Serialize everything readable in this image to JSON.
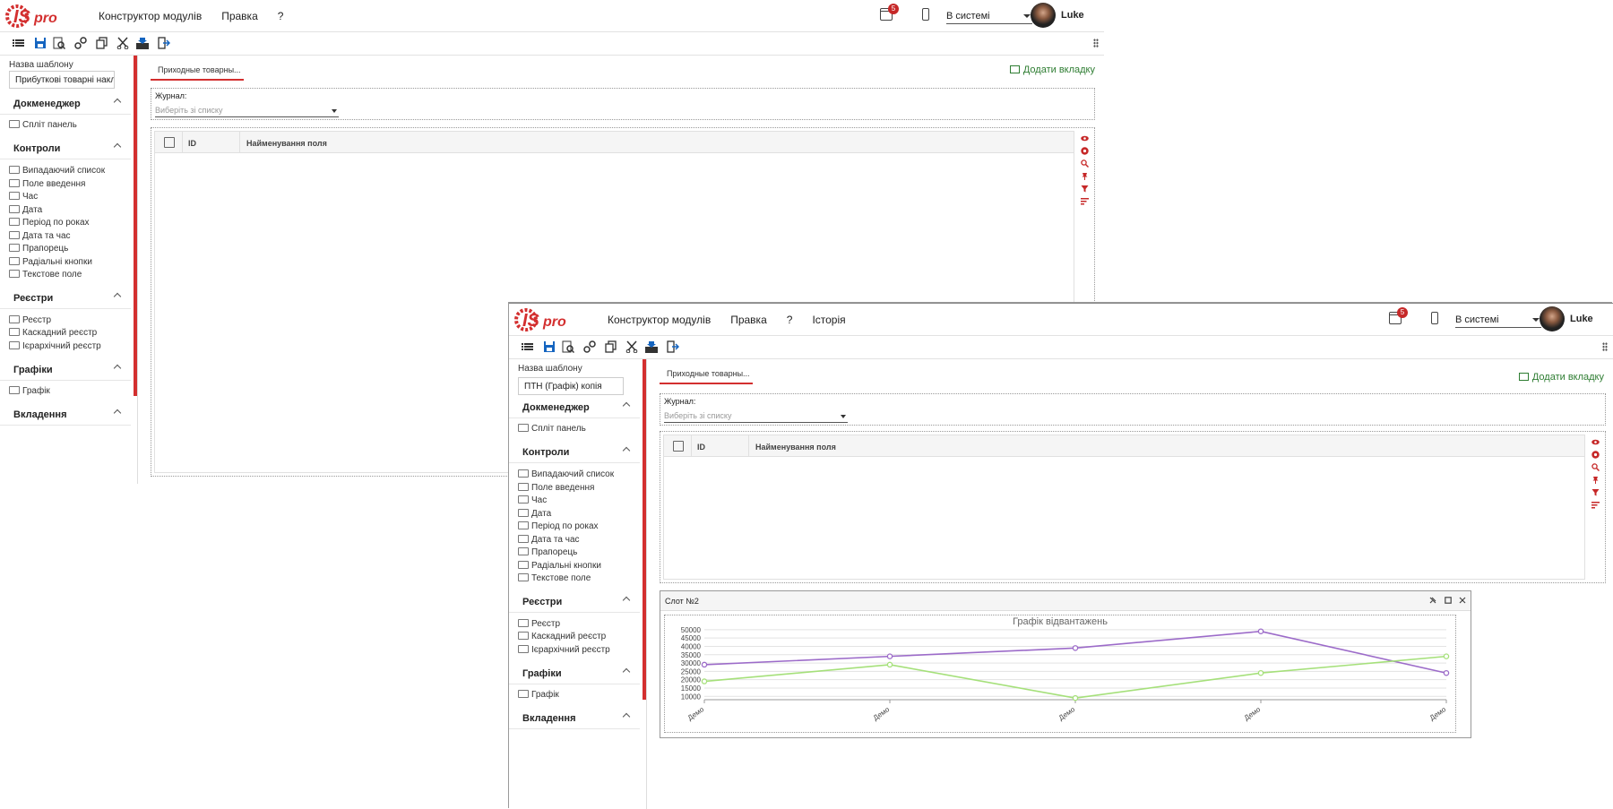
{
  "windows": [
    {
      "menu": [
        "Конструктор модулів",
        "Правка",
        "?"
      ],
      "badge": "5",
      "status": "В системі",
      "user": "Luke",
      "template_label": "Назва шаблону",
      "template_name": "Прибуткові товарні накл",
      "groups": [
        {
          "title": "Докменеджер",
          "items": [
            "Спліт панель"
          ]
        },
        {
          "title": "Контроли",
          "items": [
            "Випадаючий список",
            "Поле введення",
            "Час",
            "Дата",
            "Період по роках",
            "Дата та час",
            "Прапорець",
            "Радіальні кнопки",
            "Текстове поле"
          ]
        },
        {
          "title": "Реєстри",
          "items": [
            "Реєстр",
            "Каскадний реєстр",
            "Ієрархічний реєстр"
          ]
        },
        {
          "title": "Графіки",
          "items": [
            "Графік"
          ]
        },
        {
          "title": "Вкладення",
          "items": []
        }
      ],
      "tab": "Приходные товарны...",
      "add_tab": "Додати вкладку",
      "journal_label": "Журнал:",
      "journal_placeholder": "Виберіть зі списку",
      "grid_headers": {
        "id": "ID",
        "name": "Найменування поля"
      }
    },
    {
      "menu": [
        "Конструктор модулів",
        "Правка",
        "?",
        "Історія"
      ],
      "badge": "5",
      "status": "В системі",
      "user": "Luke",
      "template_label": "Назва шаблону",
      "template_name": "ПТН (Графік)  копія",
      "groups": [
        {
          "title": "Докменеджер",
          "items": [
            "Спліт панель"
          ]
        },
        {
          "title": "Контроли",
          "items": [
            "Випадаючий список",
            "Поле введення",
            "Час",
            "Дата",
            "Період по роках",
            "Дата та час",
            "Прапорець",
            "Радіальні кнопки",
            "Текстове поле"
          ]
        },
        {
          "title": "Реєстри",
          "items": [
            "Реєстр",
            "Каскадний реєстр",
            "Ієрархічний реєстр"
          ]
        },
        {
          "title": "Графіки",
          "items": [
            "Графік"
          ]
        },
        {
          "title": "Вкладення",
          "items": []
        }
      ],
      "tab": "Приходные товарны...",
      "add_tab": "Додати вкладку",
      "journal_label": "Журнал:",
      "journal_placeholder": "Виберіть зі списку",
      "grid_headers": {
        "id": "ID",
        "name": "Найменування поля"
      },
      "slot_title": "Слот №2"
    }
  ],
  "colors": {
    "accent": "#d32f2f",
    "green": "#2e7d32",
    "series1": "#9c6bc9",
    "series2": "#a5e07a"
  },
  "chart_data": {
    "type": "line",
    "title": "Графік відвантажень",
    "categories": [
      "Демо",
      "Демо",
      "Демо",
      "Демо",
      "Демо"
    ],
    "yticks": [
      10000,
      15000,
      20000,
      25000,
      30000,
      35000,
      40000,
      45000,
      50000
    ],
    "ylim": [
      8000,
      51000
    ],
    "series": [
      {
        "values": [
          29000,
          34000,
          39000,
          49000,
          24000
        ],
        "color": "#9c6bc9"
      },
      {
        "values": [
          19000,
          29000,
          9000,
          24000,
          34000
        ],
        "color": "#a5e07a"
      }
    ],
    "grid": true
  }
}
